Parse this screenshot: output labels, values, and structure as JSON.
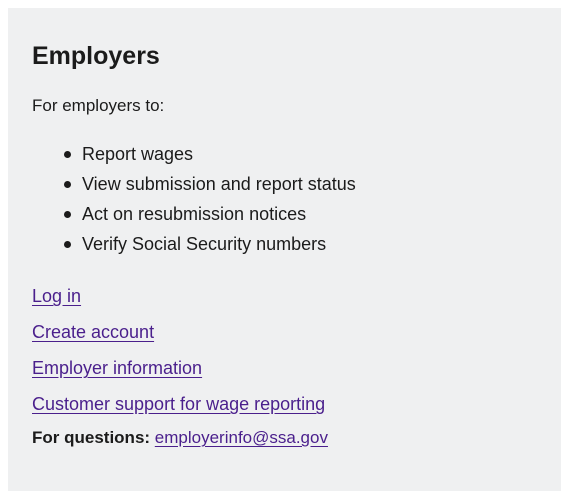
{
  "card": {
    "title": "Employers",
    "intro": "For employers to:",
    "bullets": [
      "Report wages",
      "View submission and report status",
      "Act on resubmission notices",
      "Verify Social Security numbers"
    ],
    "links": [
      "Log in",
      "Create account",
      "Employer information",
      "Customer support for wage reporting"
    ],
    "questions_label": "For questions:",
    "questions_email": "employerinfo@ssa.gov"
  },
  "colors": {
    "card_background": "#eff0f1",
    "link": "#4a1f8c",
    "text": "#1b1b1b"
  }
}
